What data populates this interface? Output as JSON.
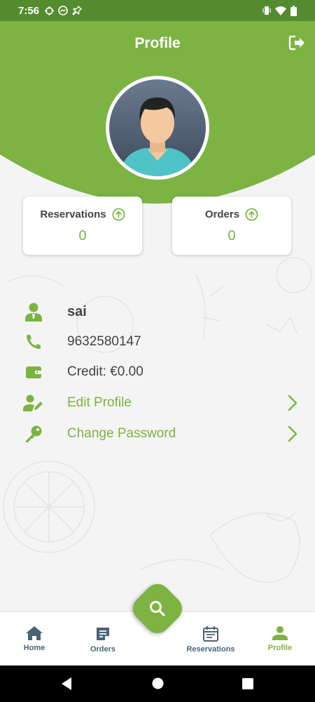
{
  "status_bar": {
    "time": "7:56"
  },
  "header": {
    "title": "Profile"
  },
  "cards": [
    {
      "label": "Reservations",
      "value": "0"
    },
    {
      "label": "Orders",
      "value": "0"
    }
  ],
  "profile": {
    "name": "sai",
    "phone": "9632580147",
    "credit": "Credit:  €0.00",
    "edit_profile": "Edit Profile",
    "change_password": "Change Password"
  },
  "nav": [
    {
      "label": "Home"
    },
    {
      "label": "Orders"
    },
    {
      "label": "Reservations"
    },
    {
      "label": "Profile"
    }
  ],
  "colors": {
    "accent": "#7cb342",
    "header": "#7cb342",
    "status_bar": "#558b2f",
    "nav_inactive": "#4a6476"
  },
  "icons": [
    "logout-icon",
    "arrow-up-circle-icon",
    "person-icon",
    "phone-icon",
    "wallet-icon",
    "user-edit-icon",
    "key-icon",
    "chevron-right-icon",
    "search-icon",
    "home-icon",
    "orders-icon",
    "calendar-icon",
    "profile-icon"
  ]
}
